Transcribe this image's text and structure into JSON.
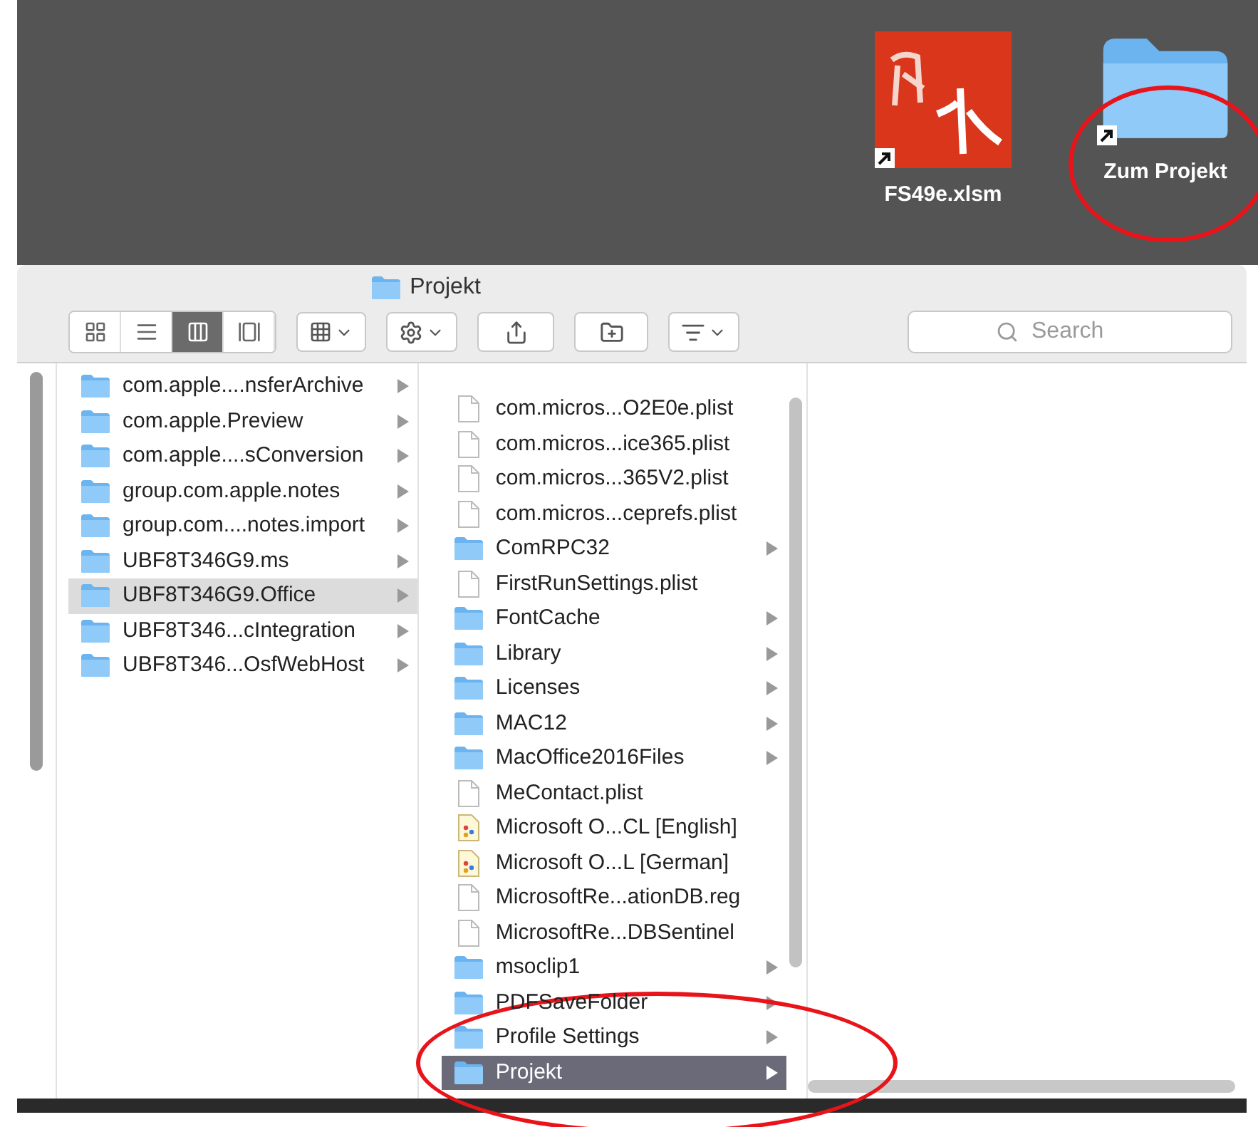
{
  "desktop": {
    "icons": [
      {
        "label": "FS49e.xlsm",
        "kind": "spreadsheet",
        "alias": true
      },
      {
        "label": "Zum Projekt",
        "kind": "folder",
        "alias": true
      }
    ]
  },
  "window": {
    "title": "Projekt"
  },
  "toolbar": {
    "view_modes": [
      {
        "kind": "icons",
        "selected": false
      },
      {
        "kind": "list",
        "selected": false
      },
      {
        "kind": "columns",
        "selected": true
      },
      {
        "kind": "gallery",
        "selected": false
      }
    ],
    "search": {
      "placeholder": "Search"
    }
  },
  "columns": [
    {
      "focused": false,
      "items": [
        {
          "name": "com.apple....nsferArchive",
          "kind": "folder",
          "selected": false
        },
        {
          "name": "com.apple.Preview",
          "kind": "folder",
          "selected": false
        },
        {
          "name": "com.apple....sConversion",
          "kind": "folder",
          "selected": false
        },
        {
          "name": "group.com.apple.notes",
          "kind": "folder",
          "selected": false
        },
        {
          "name": "group.com....notes.import",
          "kind": "folder",
          "selected": false
        },
        {
          "name": "UBF8T346G9.ms",
          "kind": "folder",
          "selected": false
        },
        {
          "name": "UBF8T346G9.Office",
          "kind": "folder",
          "selected": true
        },
        {
          "name": "UBF8T346...cIntegration",
          "kind": "folder",
          "selected": false
        },
        {
          "name": "UBF8T346...OsfWebHost",
          "kind": "folder",
          "selected": false
        }
      ]
    },
    {
      "focused": true,
      "items": [
        {
          "name": "com.micros...O2E0e.plist",
          "kind": "file",
          "selected": false
        },
        {
          "name": "com.micros...ice365.plist",
          "kind": "file",
          "selected": false
        },
        {
          "name": "com.micros...365V2.plist",
          "kind": "file",
          "selected": false
        },
        {
          "name": "com.micros...ceprefs.plist",
          "kind": "file",
          "selected": false
        },
        {
          "name": "ComRPC32",
          "kind": "folder",
          "selected": false
        },
        {
          "name": "FirstRunSettings.plist",
          "kind": "file",
          "selected": false
        },
        {
          "name": "FontCache",
          "kind": "folder",
          "selected": false
        },
        {
          "name": "Library",
          "kind": "folder",
          "selected": false
        },
        {
          "name": "Licenses",
          "kind": "folder",
          "selected": false
        },
        {
          "name": "MAC12",
          "kind": "folder",
          "selected": false
        },
        {
          "name": "MacOffice2016Files",
          "kind": "folder",
          "selected": false
        },
        {
          "name": "MeContact.plist",
          "kind": "file",
          "selected": false
        },
        {
          "name": "Microsoft O...CL [English]",
          "kind": "document",
          "selected": false
        },
        {
          "name": "Microsoft O...L [German]",
          "kind": "document",
          "selected": false
        },
        {
          "name": "MicrosoftRe...ationDB.reg",
          "kind": "file",
          "selected": false
        },
        {
          "name": "MicrosoftRe...DBSentinel",
          "kind": "file",
          "selected": false
        },
        {
          "name": "msoclip1",
          "kind": "folder",
          "selected": false
        },
        {
          "name": "PDFSaveFolder",
          "kind": "folder",
          "selected": false
        },
        {
          "name": "Profile Settings",
          "kind": "folder",
          "selected": false
        },
        {
          "name": "Projekt",
          "kind": "folder",
          "selected": true
        }
      ]
    }
  ]
}
